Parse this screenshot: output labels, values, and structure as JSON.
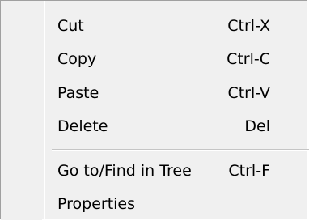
{
  "context_menu": {
    "items": [
      {
        "label": "Cut",
        "shortcut": "Ctrl-X"
      },
      {
        "label": "Copy",
        "shortcut": "Ctrl-C"
      },
      {
        "label": "Paste",
        "shortcut": "Ctrl-V"
      },
      {
        "label": "Delete",
        "shortcut": "Del"
      },
      {
        "label": "Go to/Find in Tree",
        "shortcut": "Ctrl-F"
      },
      {
        "label": "Properties",
        "shortcut": ""
      }
    ]
  },
  "colors": {
    "menu_background": "#f0f0f0",
    "menu_border": "#a0a0a0",
    "separator": "#c5c5c5",
    "text": "#000000"
  }
}
